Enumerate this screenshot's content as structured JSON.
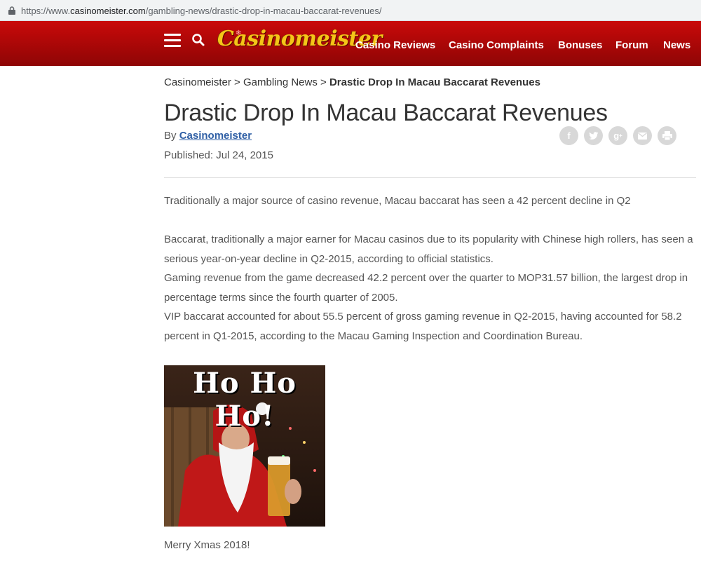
{
  "browser": {
    "url_prefix": "https://www.",
    "url_host": "casinomeister.com",
    "url_path": "/gambling-news/drastic-drop-in-macau-baccarat-revenues/"
  },
  "header": {
    "logo": "Casinomeister",
    "nav": [
      "Casino Reviews",
      "Casino Complaints",
      "Bonuses",
      "Forum",
      "News"
    ]
  },
  "breadcrumb": {
    "home": "Casinomeister",
    "sep1": ">",
    "section": "Gambling News",
    "sep2": ">",
    "current": "Drastic Drop In Macau Baccarat Revenues"
  },
  "article": {
    "title": "Drastic Drop In Macau Baccarat Revenues",
    "by_label": "By",
    "author": "Casinomeister",
    "published": "Published: Jul 24, 2015",
    "lead": "Traditionally a major source of casino revenue, Macau baccarat has seen a 42 percent decline in Q2",
    "p1": "Baccarat, traditionally a major earner for Macau casinos due to its popularity with Chinese high rollers, has seen a serious year-on-year decline in Q2-2015, according to official statistics.",
    "p2": "Gaming revenue from the game decreased 42.2 percent over the quarter to MOP31.57 billion, the largest drop in percentage terms since the fourth quarter of 2005.",
    "p3": "VIP baccarat accounted for about 55.5 percent of gross gaming revenue in Q2-2015, having accounted for 58.2 percent in Q1-2015, according to the Macau Gaming Inspection and Coordination Bureau.",
    "image_text": "Ho Ho Ho!",
    "caption": "Merry Xmas 2018!"
  },
  "share_icons": [
    "facebook-icon",
    "twitter-icon",
    "google-plus-icon",
    "email-icon",
    "print-icon"
  ],
  "colors": {
    "header_top": "#c90a0a",
    "header_bottom": "#8e0505",
    "logo": "#f5c518",
    "link": "#2f5fa5"
  }
}
